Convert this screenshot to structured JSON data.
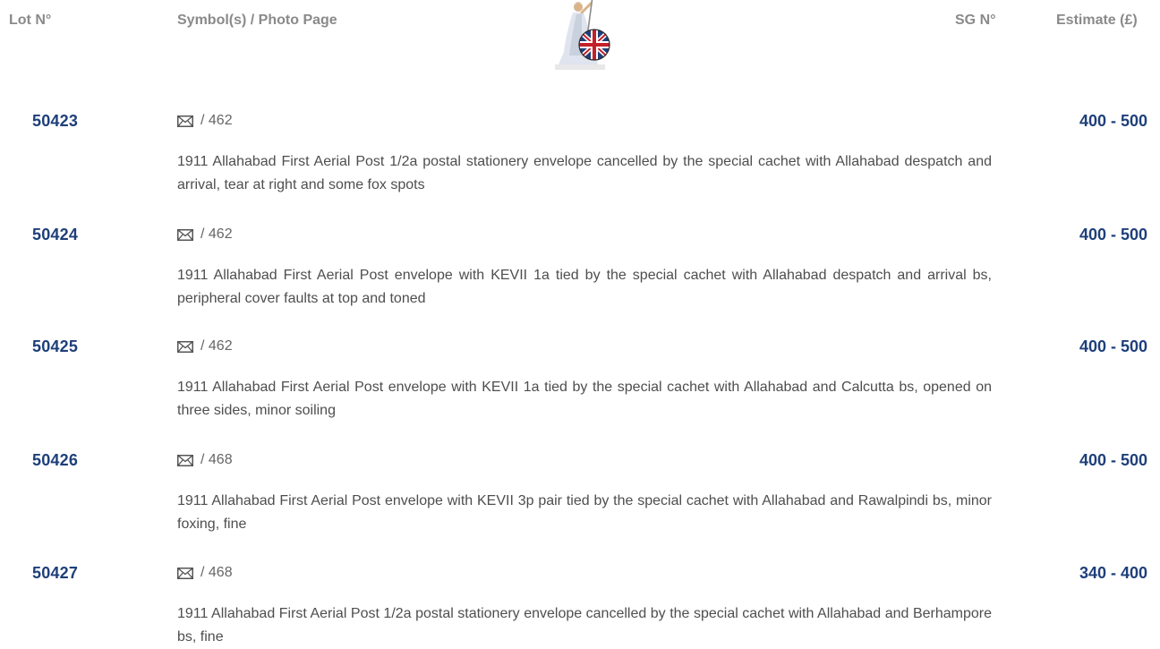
{
  "header": {
    "lot_label": "Lot N°",
    "symbol_label": "Symbol(s) / Photo Page",
    "sg_label": "SG N°",
    "estimate_label": "Estimate (£)"
  },
  "lots": [
    {
      "number": "50423",
      "symbol_icon": "envelope-icon",
      "photo_page": "/ 462",
      "description": "1911 Allahabad First Aerial Post 1/2a postal stationery envelope cancelled by the special cachet with Allahabad despatch and arrival, tear at right and some fox spots",
      "estimate": "400 - 500"
    },
    {
      "number": "50424",
      "symbol_icon": "envelope-icon",
      "photo_page": "/ 462",
      "description": "1911 Allahabad First Aerial Post envelope with KEVII 1a tied by the special cachet with Allahabad despatch and arrival bs, peripheral cover faults at top and toned",
      "estimate": "400 - 500"
    },
    {
      "number": "50425",
      "symbol_icon": "envelope-icon",
      "photo_page": "/ 462",
      "description": "1911 Allahabad First Aerial Post envelope with KEVII 1a tied by the special cachet with Allahabad and Calcutta bs, opened on three sides, minor soiling",
      "estimate": "400 - 500"
    },
    {
      "number": "50426",
      "symbol_icon": "envelope-icon",
      "photo_page": "/ 468",
      "description": "1911 Allahabad First Aerial Post envelope with KEVII 3p pair tied by the special cachet with Allahabad and Rawalpindi bs, minor foxing, fine",
      "estimate": "400 - 500"
    },
    {
      "number": "50427",
      "symbol_icon": "envelope-icon",
      "photo_page": "/ 468",
      "description": "1911 Allahabad First Aerial Post 1/2a postal stationery envelope cancelled by the special cachet with Allahabad and Berhampore bs, fine",
      "estimate": "340 - 400"
    }
  ],
  "colors": {
    "header_text": "#8a8a8a",
    "accent_blue": "#1e3f7a",
    "body_text": "#4e4e4e"
  }
}
